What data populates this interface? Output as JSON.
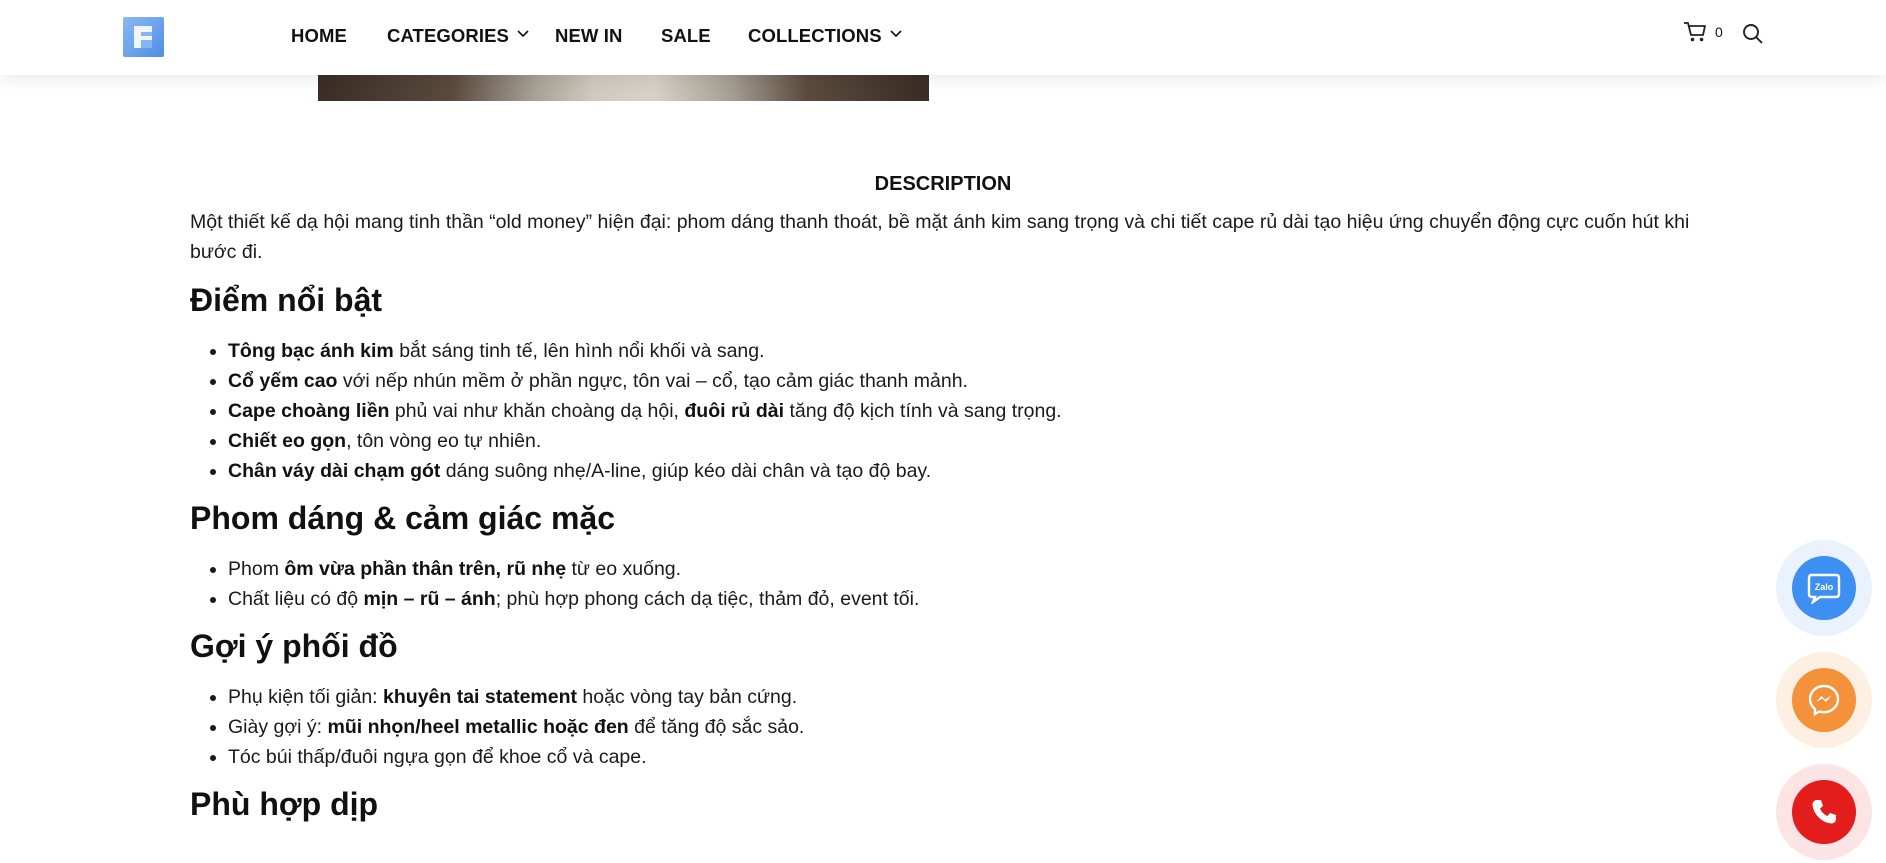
{
  "header": {
    "nav": [
      {
        "label": "HOME",
        "has_dropdown": false
      },
      {
        "label": "CATEGORIES",
        "has_dropdown": true
      },
      {
        "label": "NEW IN",
        "has_dropdown": false
      },
      {
        "label": "SALE",
        "has_dropdown": false
      },
      {
        "label": "COLLECTIONS",
        "has_dropdown": true
      }
    ],
    "cart_count": "0",
    "icons": {
      "logo": "brand-logo",
      "cart": "cart-icon",
      "search": "search-icon",
      "chevron": "chevron-down-icon"
    }
  },
  "description": {
    "title": "DESCRIPTION",
    "intro": "Một thiết kế dạ hội mang tinh thần “old money” hiện đại: phom dáng thanh thoát, bề mặt ánh kim sang trọng và chi tiết cape rủ dài tạo hiệu ứng chuyển động cực cuốn hút khi bước đi.",
    "sections": [
      {
        "heading": "Điểm nổi bật",
        "items": [
          {
            "bold": "Tông bạc ánh kim",
            "text": " bắt sáng tinh tế, lên hình nổi khối và sang."
          },
          {
            "bold": "Cổ yếm cao",
            "text": " với nếp nhún mềm ở phần ngực, tôn vai – cổ, tạo cảm giác thanh mảnh."
          },
          {
            "bold": "Cape choàng liền",
            "text": " phủ vai như khăn choàng dạ hội, ",
            "bold2": "đuôi rủ dài",
            "text2": " tăng độ kịch tính và sang trọng."
          },
          {
            "bold": "Chiết eo gọn",
            "text": ", tôn vòng eo tự nhiên."
          },
          {
            "bold": "Chân váy dài chạm gót",
            "text": " dáng suông nhẹ/A-line, giúp kéo dài chân và tạo độ bay."
          }
        ]
      },
      {
        "heading": "Phom dáng & cảm giác mặc",
        "items": [
          {
            "pre": "Phom ",
            "bold": "ôm vừa phần thân trên, rũ nhẹ",
            "text": " từ eo xuống."
          },
          {
            "pre": "Chất liệu có độ ",
            "bold": "mịn – rũ – ánh",
            "text": "; phù hợp phong cách dạ tiệc, thảm đỏ, event tối."
          }
        ]
      },
      {
        "heading": "Gợi ý phối đồ",
        "items": [
          {
            "pre": "Phụ kiện tối giản: ",
            "bold": "khuyên tai statement",
            "text": " hoặc vòng tay bản cứng."
          },
          {
            "pre": "Giày gợi ý: ",
            "bold": "mũi nhọn/heel metallic hoặc đen",
            "text": " để tăng độ sắc sảo."
          },
          {
            "pre": "Tóc búi thấp/đuôi ngựa gọn để khoe cổ và cape."
          }
        ]
      },
      {
        "heading": "Phù hợp dịp",
        "items": []
      }
    ]
  },
  "floating": {
    "zalo_label": "Zalo",
    "colors": {
      "zalo": "#3d8ff2",
      "messenger": "#f3923a",
      "phone": "#e31c1c"
    }
  }
}
